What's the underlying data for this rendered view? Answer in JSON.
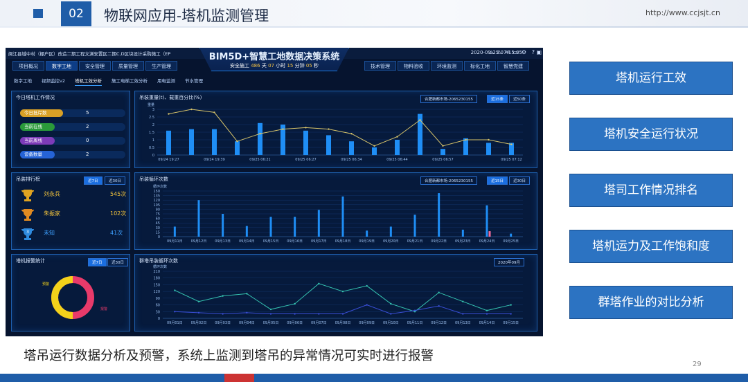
{
  "slide": {
    "number": "02",
    "title": "物联网应用-塔机监测管理",
    "url": "http://www.ccjsjt.cn",
    "caption": "塔吊运行数据分析及预警，系统上监测到塔吊的异常情况可实时进行报警",
    "page_num": "29"
  },
  "side_buttons": [
    "塔机运行工效",
    "塔机安全运行状况",
    "塔司工作情况排名",
    "塔机运力及工作饱和度",
    "群塔作业的对比分析"
  ],
  "app": {
    "project": "闽江县城中村（棚户区）改造二期工程文渊安置区二期C,D区块设计采购施工（EP",
    "title": "BIM5D+智慧工地数据决策系统",
    "safety_prefix": "安全施工",
    "days": "486",
    "days_unit": "天",
    "hours": "07",
    "hours_unit": "小时",
    "minutes": "15",
    "minutes_unit": "分钟",
    "seconds": "05",
    "seconds_unit": "秒",
    "datetime": "2020-09-25 07:15:05",
    "nav_left": [
      "项目概况",
      "数字工地",
      "安全管理",
      "质量管理",
      "生产管理"
    ],
    "nav_right": [
      "技术管理",
      "物料验收",
      "环境监测",
      "标化工地",
      "智慧党建"
    ],
    "subnav": [
      "数字工地",
      "视频监控v2",
      "塔机工效分析",
      "施工电梯工效分析",
      "用电监测",
      "节水管理"
    ],
    "subnav_active": 2
  },
  "today": {
    "title": "今日塔机工作情况",
    "items": [
      {
        "label": "今日抵岸数",
        "value": "5",
        "color": "#d9a026"
      },
      {
        "label": "当前在线",
        "value": "2",
        "color": "#2a9a3a"
      },
      {
        "label": "当前离线",
        "value": "0",
        "color": "#7d3bb8"
      },
      {
        "label": "设备数量",
        "value": "2",
        "color": "#2563d6"
      }
    ]
  },
  "ranking": {
    "title": "吊装排行榜",
    "tabs": [
      "近7日",
      "近30日"
    ],
    "items": [
      {
        "name": "刘永兵",
        "count": "545次",
        "color": "#e0a321"
      },
      {
        "name": "朱振家",
        "count": "102次",
        "color": "#e08a21"
      },
      {
        "name": "未知",
        "count": "41次",
        "color": "#2e8be0"
      }
    ]
  },
  "alarm": {
    "title": "塔机报警统计",
    "tabs": [
      "近7日",
      "近30日"
    ],
    "labels": [
      "预警",
      "报警"
    ]
  },
  "chart1": {
    "title": "吊装重量(t)、载重百分比(%)",
    "select": "合肥新都市场-2065230155",
    "tabs": [
      "近15条",
      "近50条"
    ]
  },
  "chart2": {
    "title": "吊装循环次数",
    "select": "合肥新都市场-2065230155",
    "tabs": [
      "近15日",
      "近30日"
    ]
  },
  "chart3": {
    "title": "群塔吊装循环次数",
    "select": "2020年09月"
  },
  "chart_data": [
    {
      "type": "bar",
      "title": "吊装重量(t)、载重百分比(%)",
      "ylabel": "重量",
      "ylim": [
        0,
        3
      ],
      "yticks": [
        0,
        0.5,
        1,
        1.5,
        2,
        2.5,
        3
      ],
      "x": [
        "09/24 19:27",
        "09/24 19:39",
        "09/25 06:21",
        "09/25 06:27",
        "09/25 06:34",
        "09/25 06:44",
        "09/25 06:57",
        "09/25 07:12"
      ],
      "series": [
        {
          "type": "bar",
          "values": [
            1.6,
            1.7,
            1.7,
            0.9,
            2.1,
            2.0,
            1.6,
            1.3,
            0.9,
            0.5,
            1.0,
            2.7,
            0.4,
            1.1,
            0.8,
            0.8
          ]
        },
        {
          "type": "line",
          "values": [
            2.7,
            3.0,
            2.8,
            0.9,
            1.4,
            1.7,
            1.8,
            1.7,
            1.4,
            0.6,
            1.2,
            2.3,
            0.6,
            1.0,
            1.0,
            0.7
          ]
        }
      ]
    },
    {
      "type": "bar",
      "title": "吊装循环次数",
      "ylabel": "循环次数",
      "ylim": [
        0,
        150
      ],
      "yticks": [
        0,
        15,
        30,
        45,
        60,
        75,
        90,
        105,
        120,
        135,
        150
      ],
      "x": [
        "09月11日",
        "09月12日",
        "09月13日",
        "09月14日",
        "09月15日",
        "09月16日",
        "09月17日",
        "09月18日",
        "09月19日",
        "09月20日",
        "09月21日",
        "09月22日",
        "09月23日",
        "09月24日",
        "09月25日"
      ],
      "series": [
        {
          "type": "bar",
          "values": [
            33,
            120,
            75,
            35,
            65,
            65,
            88,
            132,
            20,
            33,
            72,
            143,
            23,
            103,
            10
          ]
        },
        {
          "type": "bar",
          "values": [
            0,
            0,
            0,
            0,
            0,
            0,
            0,
            0,
            0,
            0,
            0,
            0,
            0,
            18,
            0
          ]
        }
      ]
    },
    {
      "type": "line",
      "title": "群塔吊装循环次数",
      "ylabel": "循环次数",
      "ylim": [
        0,
        210
      ],
      "yticks": [
        0,
        30,
        60,
        90,
        120,
        150,
        180,
        210
      ],
      "x": [
        "09月01日",
        "09月02日",
        "09月03日",
        "09月04日",
        "09月05日",
        "09月06日",
        "09月07日",
        "09月08日",
        "09月09日",
        "09月10日",
        "09月11日",
        "09月12日",
        "09月13日",
        "09月14日",
        "09月15日"
      ],
      "series": [
        {
          "values": [
            125,
            75,
            100,
            110,
            40,
            65,
            155,
            120,
            145,
            65,
            30,
            115,
            75,
            35,
            60
          ],
          "color": "#35c3b0"
        },
        {
          "values": [
            30,
            25,
            20,
            25,
            20,
            20,
            20,
            20,
            60,
            20,
            35,
            55,
            20,
            20,
            20
          ],
          "color": "#3a4fd8"
        }
      ]
    }
  ]
}
